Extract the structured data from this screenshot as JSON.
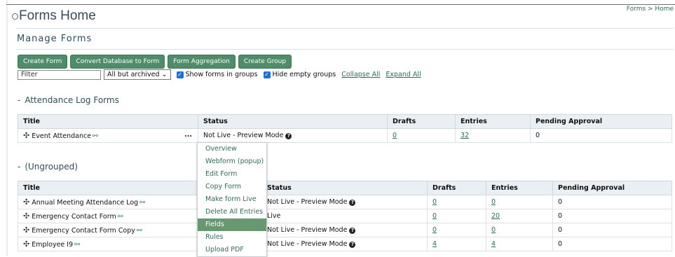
{
  "breadcrumb": "Forms > Home",
  "page_title": "Forms Home",
  "section_title": "Manage Forms",
  "buttons": [
    "Create Form",
    "Convert Database to Form",
    "Form Aggregation",
    "Create Group"
  ],
  "filter": {
    "placeholder": "Filter",
    "value": ""
  },
  "archive_select": "All but archived",
  "show_groups_label": "Show forms in groups",
  "hide_empty_label": "Hide empty groups",
  "collapse_all": "Collapse All",
  "expand_all": "Expand All",
  "groups": [
    {
      "dash": "-",
      "name": "Attendance Log Forms",
      "columns": [
        "Title",
        "Status",
        "Drafts",
        "Entries",
        "Pending Approval"
      ],
      "rows": [
        {
          "title": "Event Attendance",
          "status": "Not Live - Preview Mode",
          "drafts": "0",
          "entries": "32",
          "pending": "0"
        }
      ]
    },
    {
      "dash": "-",
      "name": "(Ungrouped)",
      "columns": [
        "Title",
        "Status",
        "Drafts",
        "Entries",
        "Pending Approval"
      ],
      "rows": [
        {
          "title": "Annual Meeting Attendance Log",
          "status": "Not Live - Preview Mode",
          "drafts": "0",
          "entries": "0",
          "pending": "0"
        },
        {
          "title": "Emergency Contact Form",
          "status": "Live",
          "drafts": "0",
          "entries": "20",
          "pending": "0"
        },
        {
          "title": "Emergency Contact Form Copy",
          "status": "Not Live - Preview Mode",
          "drafts": "0",
          "entries": "0",
          "pending": "0"
        },
        {
          "title": "Employee I9",
          "status": "Not Live - Preview Mode",
          "drafts": "4",
          "entries": "4",
          "pending": "0"
        }
      ]
    }
  ],
  "row_menu": {
    "trigger": "...",
    "items": [
      "Overview",
      "Webform (popup)",
      "Edit Form",
      "Copy Form",
      "Make form Live",
      "Delete All Entries",
      "Fields",
      "Rules",
      "Upload PDF"
    ],
    "active_item": "Fields"
  },
  "icons": {
    "move": "move-icon",
    "link": "link-icon",
    "help": "help-icon",
    "dropdown": "chevron-down-icon",
    "checkbox": "checkmark-icon"
  },
  "colors": {
    "button": "#4f8d6a",
    "link": "#2c6e4f",
    "header_bg": "#e9eff2",
    "menu_active": "#67986f",
    "checkbox": "#1f6fd6"
  }
}
